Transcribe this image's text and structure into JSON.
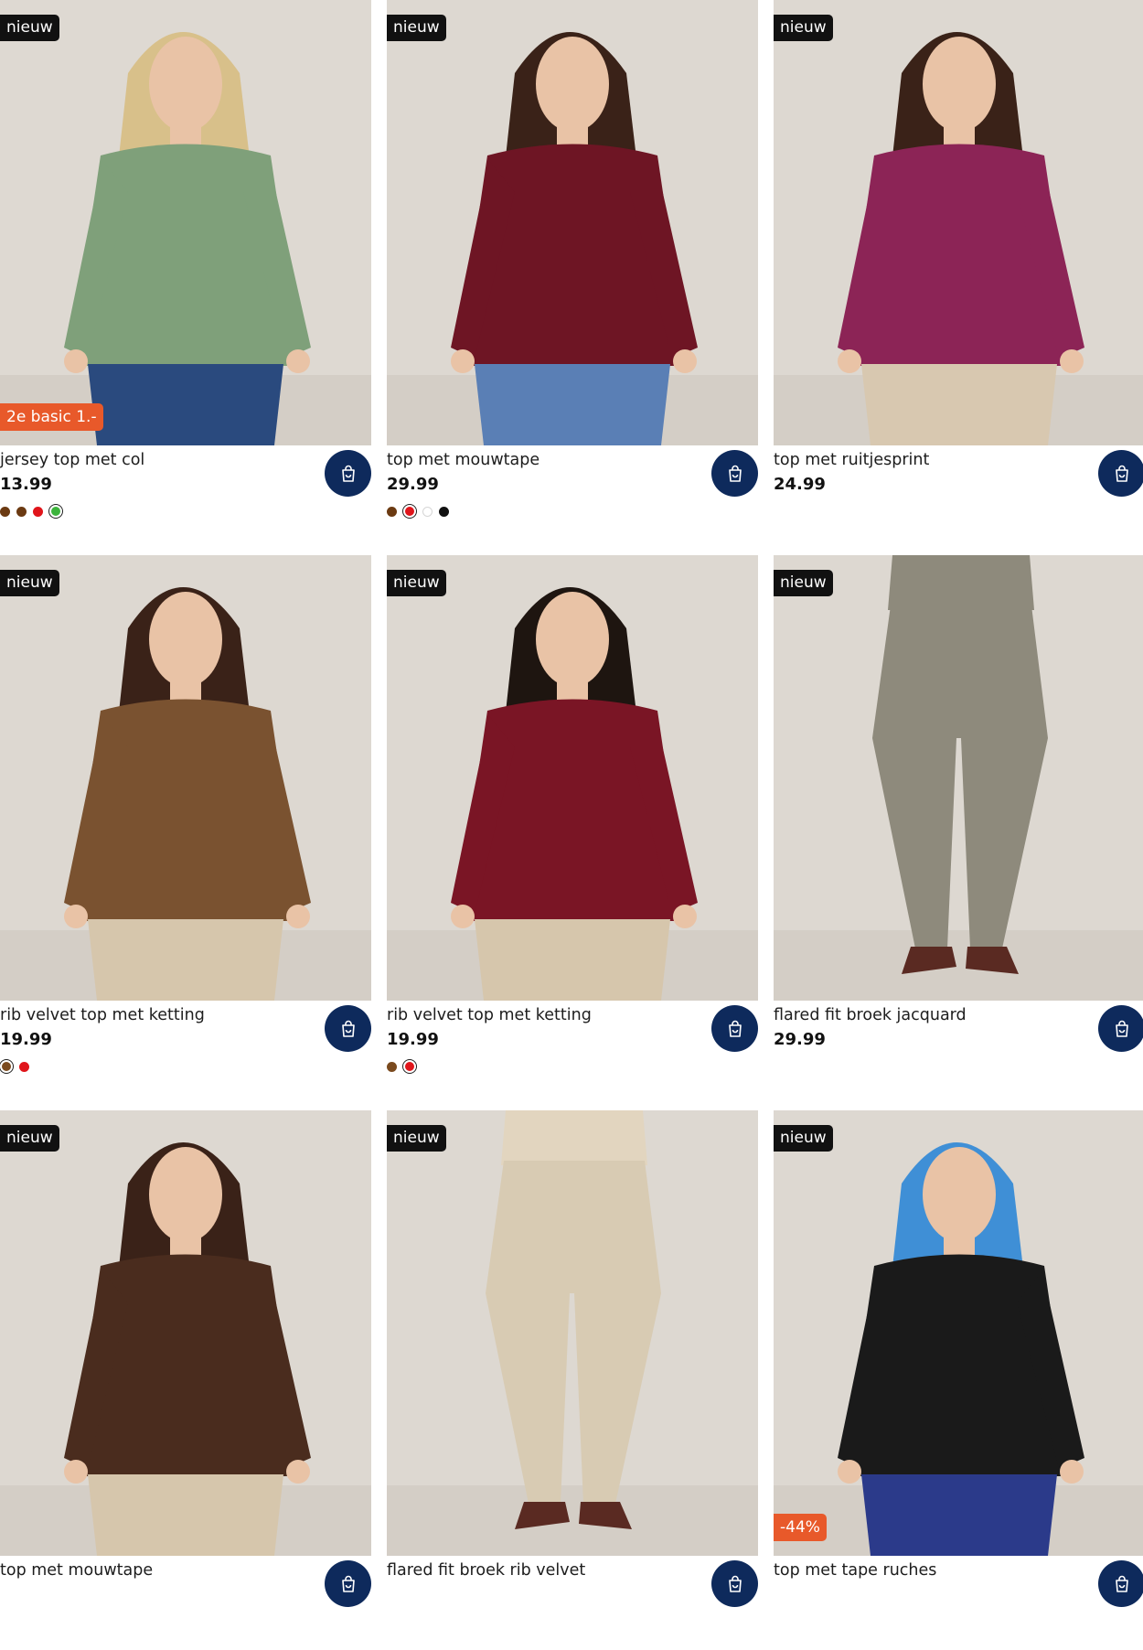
{
  "colors": {
    "cart_button": "#0e2a5c",
    "new_badge": "#111111",
    "promo_badge": "#e8592a"
  },
  "products": [
    {
      "badge": "nieuw",
      "promo": "2e basic 1.-",
      "name": "jersey top met col",
      "price": "13.99",
      "swatches": [
        "#6b3a12",
        "#6b3a12",
        "#e0151b",
        "#3cb43c"
      ],
      "selected_swatch": 3,
      "top_color": "#7fa07a",
      "bottom_color": "#2a4a7e",
      "hair_color": "#d8c08a",
      "bg_color": "#ded9d2"
    },
    {
      "badge": "nieuw",
      "name": "top met mouwtape",
      "price": "29.99",
      "swatches": [
        "#6b3a12",
        "#e0151b",
        "#ffffff",
        "#111111"
      ],
      "selected_swatch": 1,
      "top_color": "#6e1524",
      "bottom_color": "#5a7fb5",
      "hair_color": "#3a2218",
      "bg_color": "#ddd8d1"
    },
    {
      "badge": "nieuw",
      "name": "top met ruitjesprint",
      "price": "24.99",
      "swatches": [],
      "top_color": "#8c2456",
      "bottom_color": "#d8c8b0",
      "hair_color": "#3a2218",
      "bg_color": "#ddd8d1"
    },
    {
      "badge": "nieuw",
      "name": "rib velvet top met ketting",
      "price": "19.99",
      "swatches": [
        "#7a4a1e",
        "#e0151b"
      ],
      "selected_swatch": 0,
      "top_color": "#7a5230",
      "bottom_color": "#d6c6ac",
      "hair_color": "#3a2218",
      "bg_color": "#ddd8d1"
    },
    {
      "badge": "nieuw",
      "name": "rib velvet top met ketting",
      "price": "19.99",
      "swatches": [
        "#7a4a1e",
        "#e0151b"
      ],
      "selected_swatch": 1,
      "top_color": "#7a1525",
      "bottom_color": "#d6c6ac",
      "hair_color": "#1e1510",
      "bg_color": "#ddd8d1"
    },
    {
      "badge": "nieuw",
      "name": "flared fit broek jacquard",
      "price": "29.99",
      "swatches": [],
      "top_color": "#8e8a7c",
      "bottom_color": "#8e8a7c",
      "hair_color": "#8e8a7c",
      "bg_color": "#ddd8d1"
    },
    {
      "badge": "nieuw",
      "name": "top met mouwtape",
      "price": "",
      "swatches": [],
      "top_color": "#4a2c1e",
      "bottom_color": "#d6c6ac",
      "hair_color": "#3a2218",
      "bg_color": "#ddd8d1"
    },
    {
      "badge": "nieuw",
      "name": "flared fit broek rib velvet",
      "price": "",
      "swatches": [],
      "top_color": "#e2d5bf",
      "bottom_color": "#d8cbb3",
      "hair_color": "#e2d5bf",
      "bg_color": "#ddd8d1"
    },
    {
      "badge": "nieuw",
      "promo": "-44%",
      "name": "top met tape ruches",
      "price": "",
      "swatches": [],
      "top_color": "#1a1a1a",
      "bottom_color": "#2b3a8a",
      "hair_color": "#3f8fd6",
      "bg_color": "#ddd8d1"
    }
  ],
  "icons": {
    "cart": "shopping-bag-icon"
  }
}
